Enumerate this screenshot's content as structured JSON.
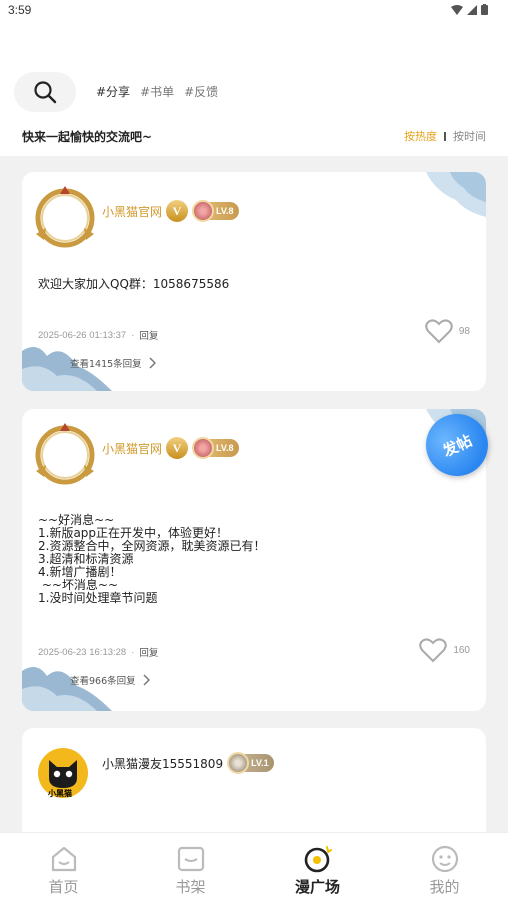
{
  "status_bar": {
    "time": "3:59"
  },
  "header": {
    "tags": [
      "#分享",
      "#书单",
      "#反馈"
    ],
    "slogan": "快来一起愉快的交流吧~",
    "sort_hot": "按热度",
    "sort_time": "按时间"
  },
  "posts": [
    {
      "user": "小黑猫官网",
      "verified_badge": "V",
      "level": "LV.8",
      "content": "欢迎大家加入QQ群：1058675586",
      "date": "2025-06-26 01:13:37",
      "reply_label": "回复",
      "view_replies": "查看1415条回复",
      "likes": "98"
    },
    {
      "user": "小黑猫官网",
      "verified_badge": "V",
      "level": "LV.8",
      "content": "~~好消息~~\n1.新版app正在开发中，体验更好！\n2.资源整合中，全网资源，耽美资源已有！\n3.超清和标清资源\n4.新增广播剧！\n ~~坏消息~~\n1.没时间处理章节问题",
      "date": "2025-06-23 16:13:28",
      "reply_label": "回复",
      "view_replies": "查看966条回复",
      "likes": "160"
    },
    {
      "user": "小黑猫漫友15551809",
      "level": "LV.1",
      "avatar_text": "小黑猫"
    }
  ],
  "fab": {
    "label": "发帖"
  },
  "tabbar": {
    "items": [
      {
        "label": "首页",
        "icon": "home-icon"
      },
      {
        "label": "书架",
        "icon": "bookshelf-icon"
      },
      {
        "label": "漫广场",
        "icon": "plaza-icon"
      },
      {
        "label": "我的",
        "icon": "profile-icon"
      }
    ],
    "active_index": 2
  },
  "colors": {
    "accent": "#e8a21b",
    "fab": "#2a86f0",
    "username_gold": "#d19a2c"
  }
}
